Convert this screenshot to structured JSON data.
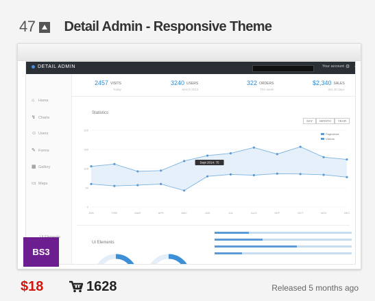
{
  "item": {
    "rank": "47",
    "title": "Detail Admin - Responsive Theme",
    "price": "$18",
    "sales": "1628",
    "released": "Released 5 months ago"
  },
  "preview": {
    "brand": "DETAIL ADMIN",
    "user_menu": "Your account",
    "sidebar": [
      {
        "label": "Home",
        "icon": "home-icon"
      },
      {
        "label": "Charts",
        "icon": "chart-icon"
      },
      {
        "label": "Users",
        "icon": "users-icon"
      },
      {
        "label": "Forms",
        "icon": "edit-icon"
      },
      {
        "label": "Gallery",
        "icon": "gallery-icon"
      },
      {
        "label": "Maps",
        "icon": "calendar-icon"
      }
    ],
    "sidebar_tail": "UI Elements",
    "badge": "BS3",
    "stats": [
      {
        "value": "2457",
        "label": "VISITS",
        "sub": "Today"
      },
      {
        "value": "3240",
        "label": "USERS",
        "sub": "March 2013"
      },
      {
        "value": "322",
        "label": "ORDERS",
        "sub": "This week"
      },
      {
        "value": "$2,340",
        "label": "SALES",
        "sub": "last 30 days"
      }
    ],
    "statistics_title": "Statistics",
    "periods": [
      "DAY",
      "MONTH",
      "YEAR"
    ],
    "legend": [
      "Pageviews",
      "Visitors"
    ],
    "tooltip": "Sept 2014: 75",
    "gauges_title": "UI Elements",
    "gauges": [
      "50",
      "75"
    ]
  },
  "chart_data": {
    "type": "line",
    "title": "Statistics",
    "categories": [
      "JAN",
      "FEB",
      "MAR",
      "APR",
      "MAY",
      "JUN",
      "JUL",
      "AUG",
      "SEP",
      "OCT",
      "NOV",
      "DEC"
    ],
    "series": [
      {
        "name": "Pageviews",
        "values": [
          106,
          112,
          93,
          95,
          120,
          134,
          140,
          155,
          138,
          157,
          130,
          124
        ]
      },
      {
        "name": "Visitors",
        "values": [
          60,
          55,
          57,
          60,
          43,
          80,
          85,
          83,
          87,
          86,
          84,
          78
        ]
      }
    ],
    "ylim": [
      0,
      200
    ],
    "grid": true,
    "legend": "top-right"
  },
  "colors": {
    "price": "#d0160d",
    "accent_blue": "#2a8bd2",
    "navbar": "#2b2f36",
    "badge": "#6c1d8f"
  }
}
